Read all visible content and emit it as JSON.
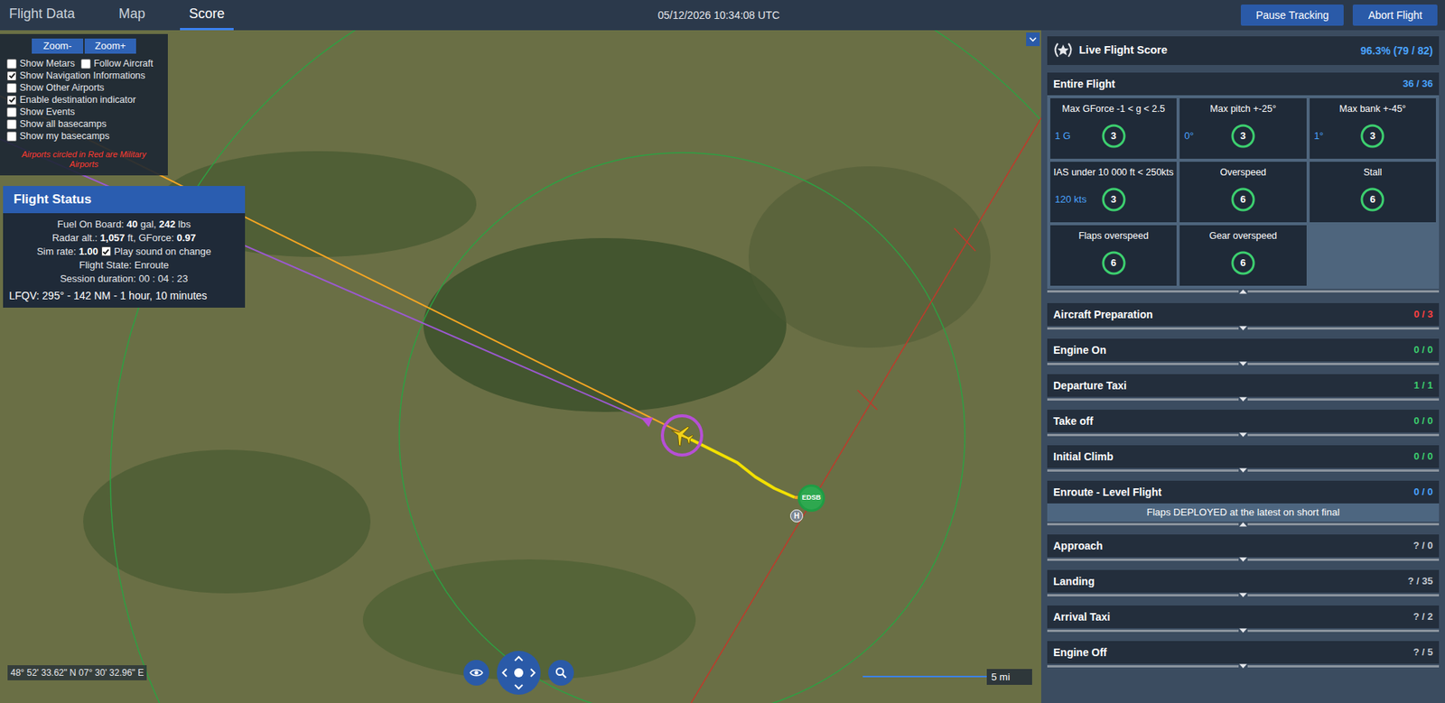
{
  "tabs": [
    {
      "label": "Flight Data",
      "selected": false
    },
    {
      "label": "Map",
      "selected": false
    },
    {
      "label": "Score",
      "selected": true
    }
  ],
  "datetime": "05/12/2026 10:34:08 UTC",
  "buttons": [
    "Pause Tracking",
    "Abort Flight"
  ],
  "map": {
    "controls": {
      "zoom": [
        "Zoom-",
        "Zoom+"
      ],
      "options": [
        {
          "label": "Show Metars",
          "checked": false
        },
        {
          "label": "Follow Aircraft",
          "checked": false
        },
        {
          "label": "Show Navigation Informations",
          "checked": true
        },
        {
          "label": "Show Other Airports",
          "checked": false
        },
        {
          "label": "Enable destination indicator",
          "checked": true
        },
        {
          "label": "Show Events",
          "checked": false
        },
        {
          "label": "Show all basecamps",
          "checked": false
        },
        {
          "label": "Show my basecamps",
          "checked": false
        }
      ],
      "note": "Airports circled in Red are Military Airports"
    },
    "flight_status": {
      "title": "Flight Status",
      "lines": [
        [
          {
            "kind": "text",
            "text": "Fuel On Board: ",
            "bold": false
          },
          {
            "kind": "text",
            "text": "40",
            "bold": true
          },
          {
            "kind": "text",
            "text": " gal, ",
            "bold": false
          },
          {
            "kind": "text",
            "text": "242",
            "bold": true
          },
          {
            "kind": "text",
            "text": " lbs",
            "bold": false
          }
        ],
        [
          {
            "kind": "text",
            "text": "Radar alt.: ",
            "bold": false
          },
          {
            "kind": "text",
            "text": "1,057",
            "bold": true
          },
          {
            "kind": "text",
            "text": " ft, GForce: ",
            "bold": false
          },
          {
            "kind": "text",
            "text": "0.97",
            "bold": true
          }
        ],
        [
          {
            "kind": "text",
            "text": "Sim rate: ",
            "bold": false
          },
          {
            "kind": "text",
            "text": "1.00",
            "bold": true
          },
          {
            "kind": "checkbox",
            "checked": true
          },
          {
            "kind": "text",
            "text": "Play sound on change",
            "bold": false
          }
        ],
        [
          {
            "kind": "text",
            "text": "Flight State: Enroute",
            "bold": false
          }
        ],
        [
          {
            "kind": "text",
            "text": "Session duration: 00 : 04 : 23",
            "bold": false
          }
        ]
      ],
      "destination": "LFQV: 295° - 142 NM - 1 hour, 10 minutes"
    },
    "airport": "EDSB",
    "heliport": "H",
    "coordinates": "48° 52' 33.62\" N 07° 30' 32.96\" E",
    "scale": "5 mi"
  },
  "score": {
    "title": "Live Flight Score",
    "value": "96.3% (79 / 82)",
    "entire_flight": {
      "title": "Entire Flight",
      "value": "36 / 36",
      "expanded": true,
      "cards": [
        {
          "label": "Max GForce -1 < g < 2.5",
          "reading": "1 G",
          "points": "3",
          "level": 1
        },
        {
          "label": "Max pitch +-25°",
          "reading": "0°",
          "points": "3",
          "level": 1
        },
        {
          "label": "Max bank +-45°",
          "reading": "1°",
          "points": "3",
          "level": 1
        },
        {
          "label": "IAS under 10 000 ft < 250kts",
          "reading": "120 kts",
          "points": "3",
          "level": 1
        },
        {
          "label": "Overspeed",
          "points": "6",
          "level": 1
        },
        {
          "label": "Stall",
          "points": "6",
          "level": 1
        },
        {
          "label": "Flaps overspeed",
          "points": "6",
          "level": 1
        },
        {
          "label": "Gear overspeed",
          "points": "6",
          "level": 1
        }
      ]
    },
    "sections": [
      {
        "title": "Aircraft Preparation",
        "value": "0 / 3",
        "color": "#ff4040",
        "expanded": false
      },
      {
        "title": "Engine On",
        "value": "0 / 0",
        "color": "#3ccf6e",
        "expanded": false
      },
      {
        "title": "Departure Taxi",
        "value": "1 / 1",
        "color": "#3ccf6e",
        "expanded": false
      },
      {
        "title": "Take off",
        "value": "0 / 0",
        "color": "#3ccf6e",
        "expanded": false
      },
      {
        "title": "Initial Climb",
        "value": "0 / 0",
        "color": "#3ccf6e",
        "expanded": false
      },
      {
        "title": "Enroute - Level Flight",
        "value": "0 / 0",
        "color": "#4aa3ff",
        "expanded": true,
        "note": "Flaps DEPLOYED at the latest on short final"
      },
      {
        "title": "Approach",
        "value": "? / 0",
        "color": "#c3c9d0",
        "expanded": false
      },
      {
        "title": "Landing",
        "value": "? / 35",
        "color": "#c3c9d0",
        "expanded": false
      },
      {
        "title": "Arrival Taxi",
        "value": "? / 2",
        "color": "#c3c9d0",
        "expanded": false
      },
      {
        "title": "Engine Off",
        "value": "? / 5",
        "color": "#c3c9d0",
        "expanded": false
      }
    ]
  }
}
